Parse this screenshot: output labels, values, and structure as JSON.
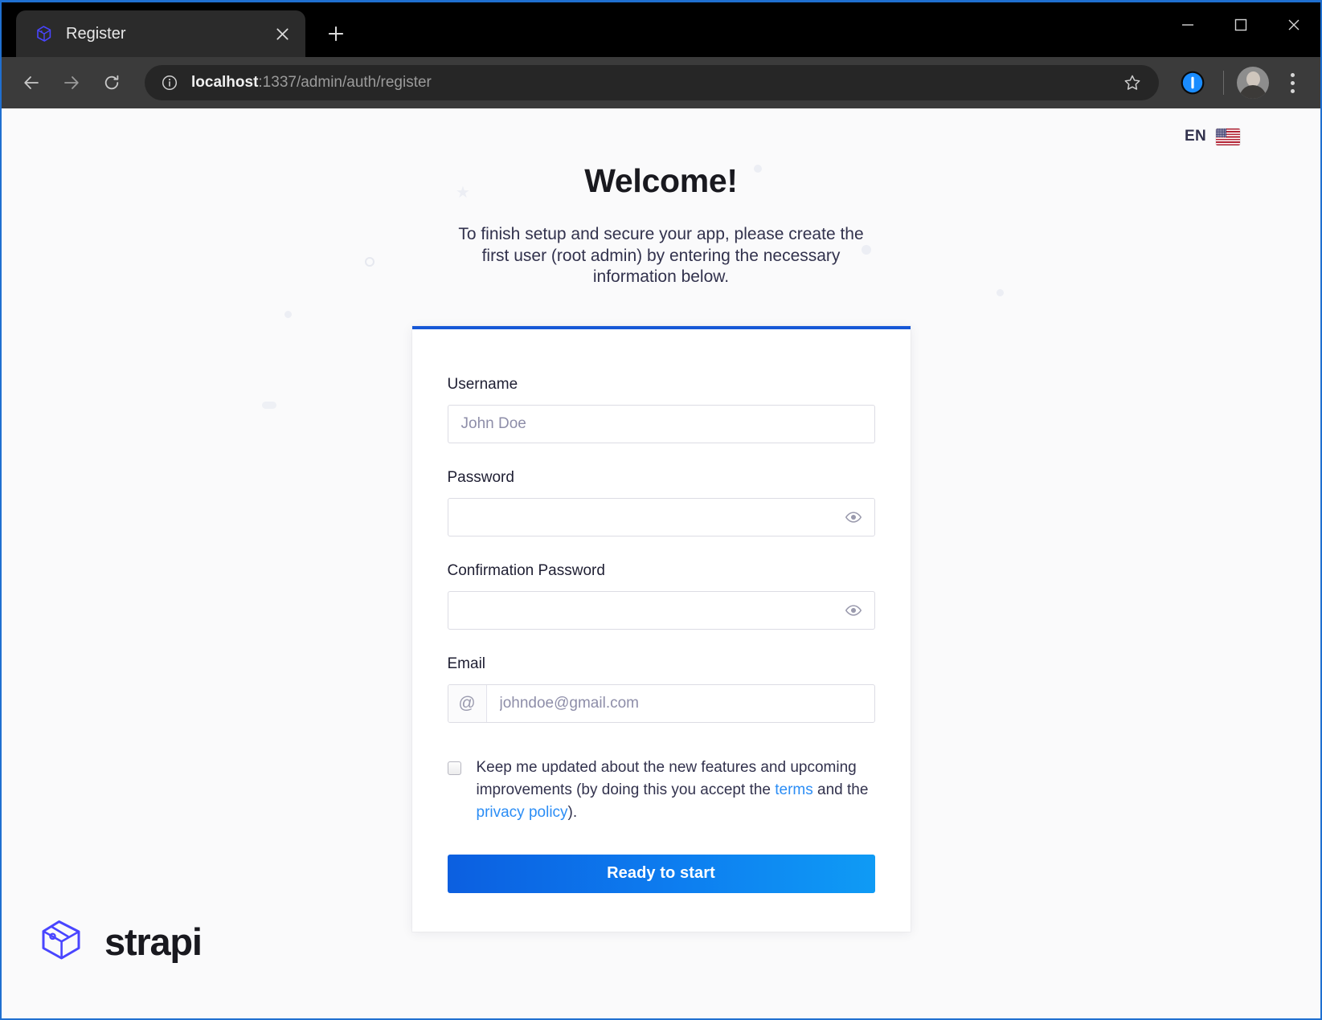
{
  "browser": {
    "tab": {
      "title": "Register",
      "favicon_icon": "strapi-favicon",
      "close_icon": "close-icon"
    },
    "new_tab_icon": "plus-icon",
    "window_controls": {
      "minimize_icon": "minimize-icon",
      "maximize_icon": "maximize-icon",
      "close_icon": "close-icon"
    },
    "nav": {
      "back_icon": "arrow-left-icon",
      "forward_icon": "arrow-right-icon",
      "reload_icon": "reload-icon"
    },
    "omnibox": {
      "info_icon": "info-circle-icon",
      "url_host": "localhost",
      "url_path": ":1337/admin/auth/register",
      "bookmark_icon": "star-icon"
    },
    "extension_icon": "password-manager-icon",
    "profile_icon": "avatar",
    "menu_icon": "kebab-menu-icon"
  },
  "language": {
    "code": "EN",
    "flag_icon": "flag-us-icon"
  },
  "page": {
    "heading": "Welcome!",
    "subtitle": "To finish setup and secure your app, please create the first user (root admin) by entering the necessary information below.",
    "accent_color": "#1657d6"
  },
  "form": {
    "username": {
      "label": "Username",
      "value": "",
      "placeholder": "John Doe"
    },
    "password": {
      "label": "Password",
      "value": "",
      "placeholder": "",
      "toggle_icon": "eye-icon"
    },
    "confirm_password": {
      "label": "Confirmation Password",
      "value": "",
      "placeholder": "",
      "toggle_icon": "eye-icon"
    },
    "email": {
      "label": "Email",
      "value": "",
      "placeholder": "johndoe@gmail.com",
      "prefix": "@"
    },
    "consent": {
      "checked": false,
      "text_before": "Keep me updated about the new features and upcoming improvements (by doing this you accept the ",
      "terms_link": "terms",
      "text_middle": " and the ",
      "privacy_link": "privacy policy",
      "text_after": ")."
    },
    "submit_label": "Ready to start",
    "submit_gradient_from": "#0c5fe0",
    "submit_gradient_to": "#0f9bf5"
  },
  "brand": {
    "name": "strapi",
    "logo_icon": "strapi-logo-icon",
    "logo_color": "#4945ff"
  }
}
